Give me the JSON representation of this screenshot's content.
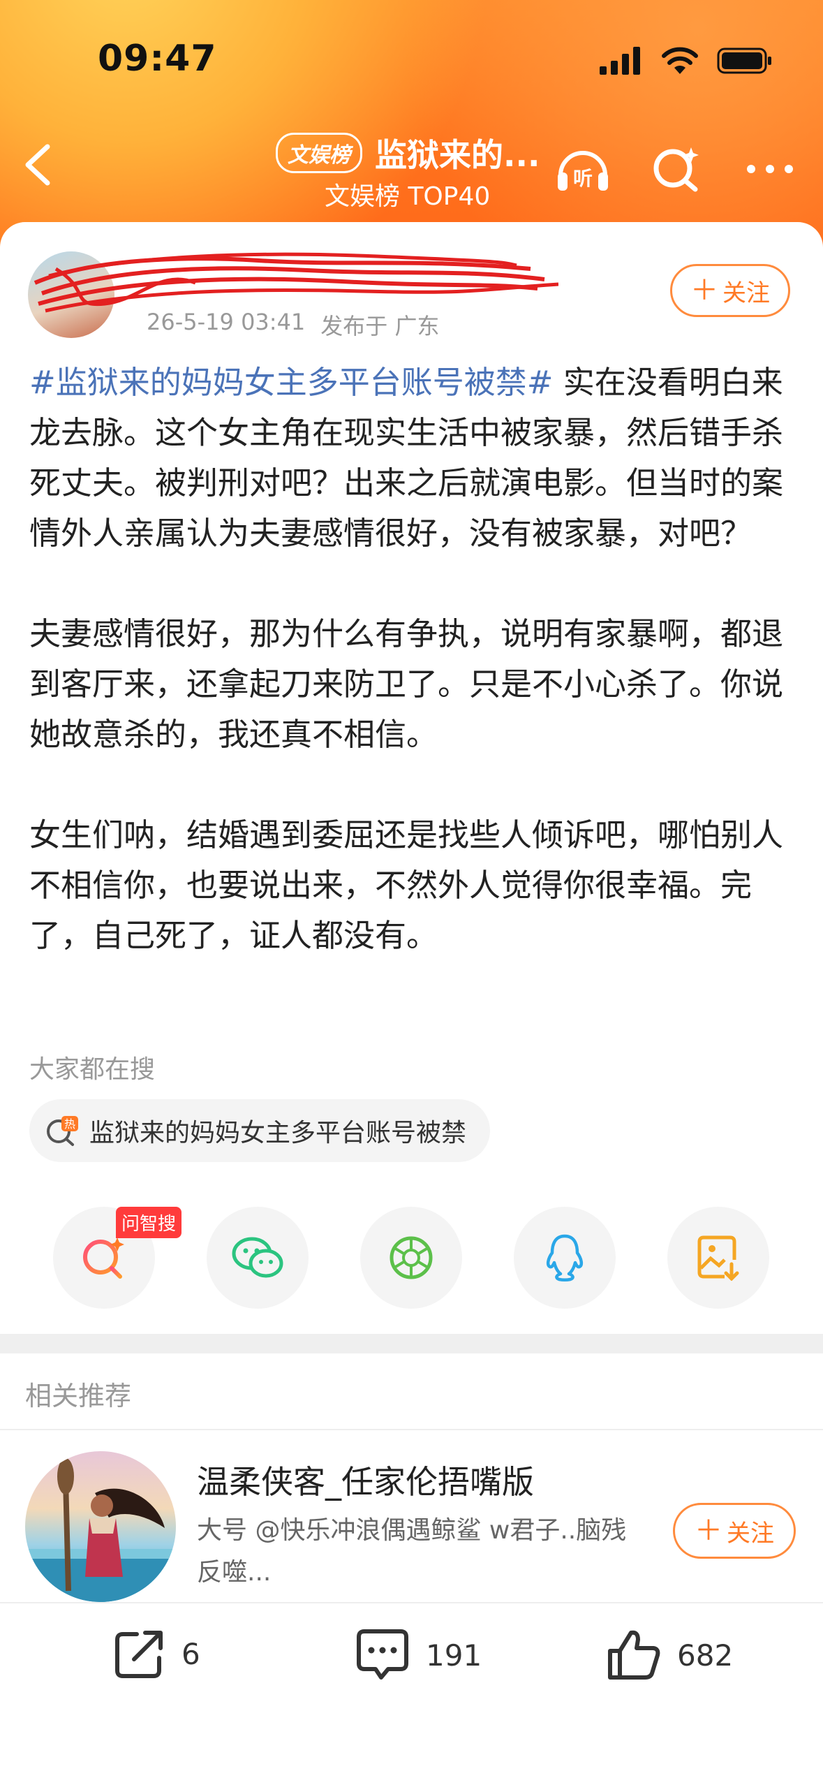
{
  "status_bar": {
    "time": "09:47"
  },
  "nav": {
    "badge": "文娱榜",
    "title": "监狱来的...",
    "subtitle": "文娱榜 TOP40",
    "listen_label": "听"
  },
  "post": {
    "date": "26-5-19 03:41",
    "location": "发布于 广东",
    "follow_label": "关注",
    "hashtag": "#监狱来的妈妈女主多平台账号被禁#",
    "paragraph1_rest": " 实在没看明白来龙去脉。这个女主角在现实生活中被家暴，然后错手杀死丈夫。被判刑对吧？出来之后就演电影。但当时的案情外人亲属认为夫妻感情很好，没有被家暴，对吧？",
    "paragraph2": "夫妻感情很好，那为什么有争执，说明有家暴啊，都退到客厅来，还拿起刀来防卫了。只是不小心杀了。你说她故意杀的，我还真不相信。",
    "paragraph3": "女生们呐，结婚遇到委屈还是找些人倾诉吧，哪怕别人不相信你，也要说出来，不然外人觉得你很幸福。完了，自己死了，证人都没有。"
  },
  "search": {
    "hint": "大家都在搜",
    "hot_badge": "热",
    "hot_item": "监狱来的妈妈女主多平台账号被禁"
  },
  "share": {
    "ai_tag": "问智搜"
  },
  "recommend": {
    "section_title": "相关推荐",
    "name": "温柔侠客_任家伦捂嘴版",
    "desc": "大号 @快乐冲浪偶遇鲸鲨  w君子..脑残反噬...",
    "follow_label": "关注"
  },
  "actions": {
    "repost": "6",
    "comments": "191",
    "likes": "682"
  },
  "colors": {
    "accent": "#ff7a26",
    "hashtag": "#4b73b8"
  }
}
